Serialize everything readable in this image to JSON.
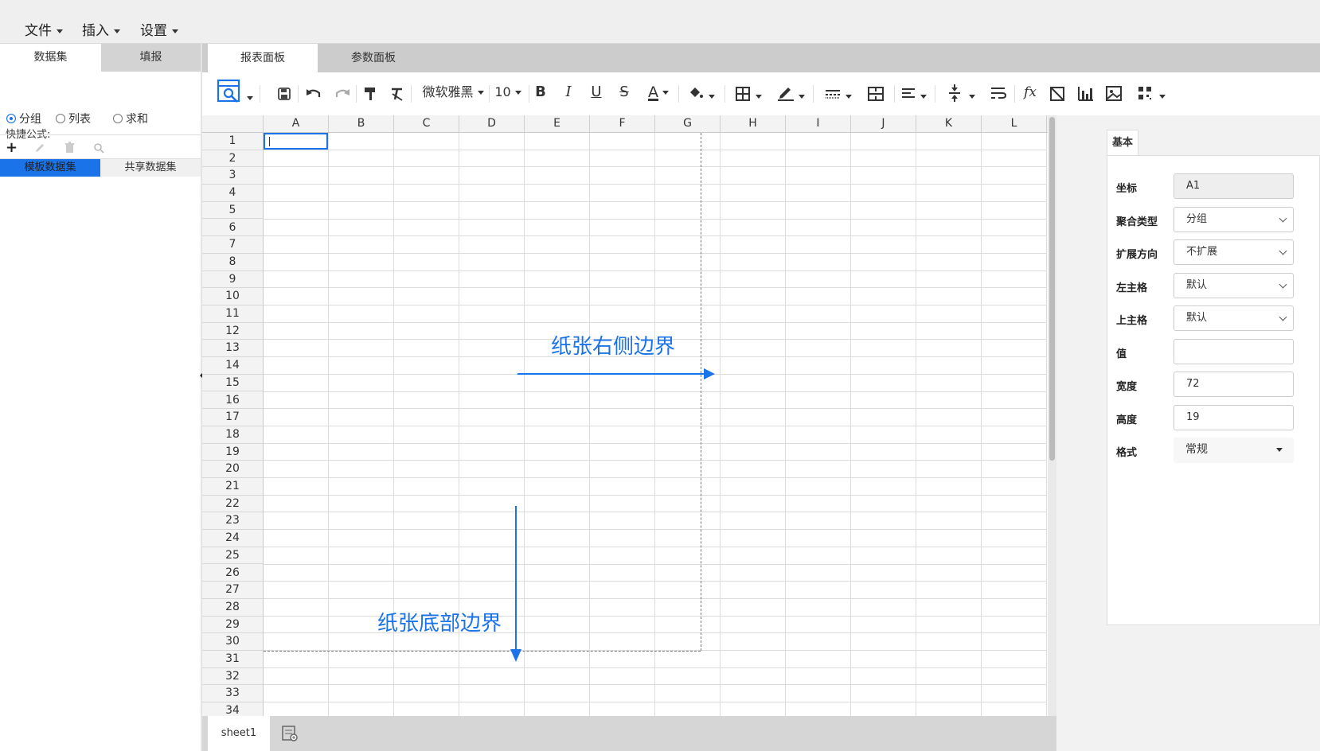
{
  "menubar": {
    "items": [
      {
        "label": "文件"
      },
      {
        "label": "插入"
      },
      {
        "label": "设置"
      }
    ]
  },
  "left_panel": {
    "tabs": [
      {
        "label": "数据集"
      },
      {
        "label": "填报"
      }
    ],
    "quick_formula_label": "快捷公式:",
    "radios": [
      {
        "label": "分组",
        "checked": true
      },
      {
        "label": "列表",
        "checked": false
      },
      {
        "label": "求和",
        "checked": false
      }
    ],
    "icons": [
      "add-icon",
      "edit-icon",
      "delete-icon",
      "search-icon"
    ],
    "subtabs": [
      {
        "label": "模板数据集"
      },
      {
        "label": "共享数据集"
      }
    ]
  },
  "main_tabs": [
    {
      "label": "报表面板"
    },
    {
      "label": "参数面板"
    }
  ],
  "toolbar": {
    "font_name": "微软雅黑",
    "font_size": "10",
    "fx_label": "fx"
  },
  "sheet": {
    "columns": [
      "A",
      "B",
      "C",
      "D",
      "E",
      "F",
      "G",
      "H",
      "I",
      "J",
      "K",
      "L"
    ],
    "rows": [
      "1",
      "2",
      "3",
      "4",
      "5",
      "6",
      "7",
      "8",
      "9",
      "10",
      "11",
      "12",
      "13",
      "14",
      "15",
      "16",
      "17",
      "18",
      "19",
      "20",
      "21",
      "22",
      "23",
      "24",
      "25",
      "26",
      "27",
      "28",
      "29",
      "30",
      "31",
      "32",
      "33",
      "34"
    ],
    "selected_cell": "A1"
  },
  "annotations": {
    "right_boundary": "纸张右侧边界",
    "bottom_boundary": "纸张底部边界"
  },
  "properties": {
    "tab": "基本",
    "fields": [
      {
        "label": "坐标",
        "value": "A1",
        "type": "readonly"
      },
      {
        "label": "聚合类型",
        "value": "分组",
        "type": "select"
      },
      {
        "label": "扩展方向",
        "value": "不扩展",
        "type": "select"
      },
      {
        "label": "左主格",
        "value": "默认",
        "type": "select"
      },
      {
        "label": "上主格",
        "value": "默认",
        "type": "select"
      },
      {
        "label": "值",
        "value": "",
        "type": "input"
      },
      {
        "label": "宽度",
        "value": "72",
        "type": "input"
      },
      {
        "label": "高度",
        "value": "19",
        "type": "input"
      },
      {
        "label": "格式",
        "value": "常规",
        "type": "dropdown"
      }
    ]
  },
  "sheet_tabs": [
    {
      "label": "sheet1"
    }
  ],
  "colors": {
    "accent": "#1a73e8",
    "annotation": "#1a73e8"
  }
}
